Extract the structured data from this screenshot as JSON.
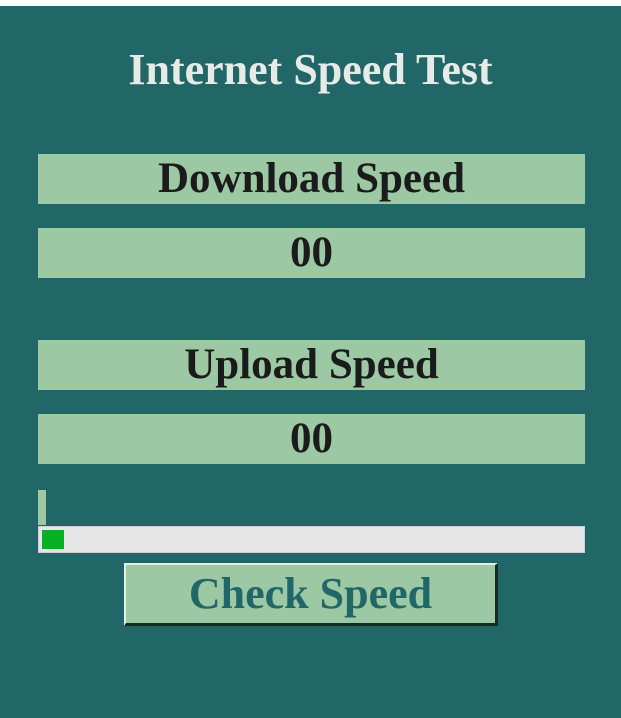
{
  "app": {
    "title": "Internet Speed Test"
  },
  "download": {
    "label": "Download Speed",
    "value": "00"
  },
  "upload": {
    "label": "Upload Speed",
    "value": "00"
  },
  "progress": {
    "fraction": 0.04
  },
  "button": {
    "label": "Check Speed"
  },
  "colors": {
    "background": "#216767",
    "panel": "#9cc8a4",
    "title_text": "#e6ebe8",
    "button_text": "#216767",
    "progress_fill": "#06b025"
  }
}
